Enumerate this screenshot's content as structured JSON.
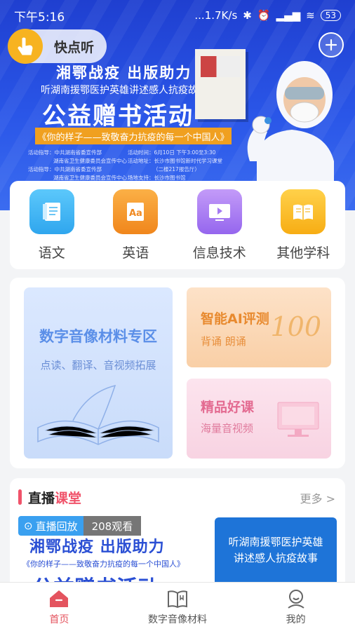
{
  "status_bar": {
    "time": "下午5:16",
    "network": "...1.7K/s",
    "battery": "53"
  },
  "top": {
    "app_name": "快点听"
  },
  "banner": {
    "line1": "湘鄂战疫 出版助力",
    "line2": "听湖南援鄂医护英雄讲述感人抗疫故事",
    "line3": "公益赠书活动",
    "line4": "《你的样子——致敬奋力抗疫的每一个中国人》",
    "info_left": [
      "活动指导：中共湖南省委宣传部",
      "湖南省卫生健康委员会宣传中心",
      "活动指导：中共湖南省委宣传部",
      "湖南省卫生健康委员会宣传中心"
    ],
    "info_right": [
      "活动时间：6月10日 下午3:00至3:30",
      "活动地址：长沙市图书馆新时代学习课堂",
      "（二楼217报告厅）",
      "场地支持：长沙市图书馆"
    ]
  },
  "subjects": [
    {
      "label": "语文",
      "color": "#3fb6f3"
    },
    {
      "label": "英语",
      "color": "#f59a27"
    },
    {
      "label": "信息技术",
      "color": "#a879f2"
    },
    {
      "label": "其他学科",
      "color": "#f7b926"
    }
  ],
  "zones": {
    "digital": {
      "title": "数字音像材料专区",
      "subtitle": "点读、翻译、音视频拓展"
    },
    "ai": {
      "title": "智能AI评测",
      "subtitle": "背诵  朗诵",
      "deco": "100"
    },
    "boutique": {
      "title": "精品好课",
      "subtitle": "海量音视频"
    }
  },
  "live": {
    "title_a": "直播",
    "title_b": "课堂",
    "more": "更多 >",
    "badge": "直播回放",
    "views": "208观看",
    "thumb1_line1": "湘鄂战疫 出版助力",
    "thumb1_line2": "《你的样子——致敬奋力抗疫的每一个中国人》",
    "thumb1_line3": "公益赠书活动",
    "thumb2_text": "听湖南援鄂医护英雄讲述感人抗疫故事"
  },
  "tabs": [
    {
      "label": "首页",
      "active": true
    },
    {
      "label": "数字音像材料",
      "active": false
    },
    {
      "label": "我的",
      "active": false
    }
  ]
}
